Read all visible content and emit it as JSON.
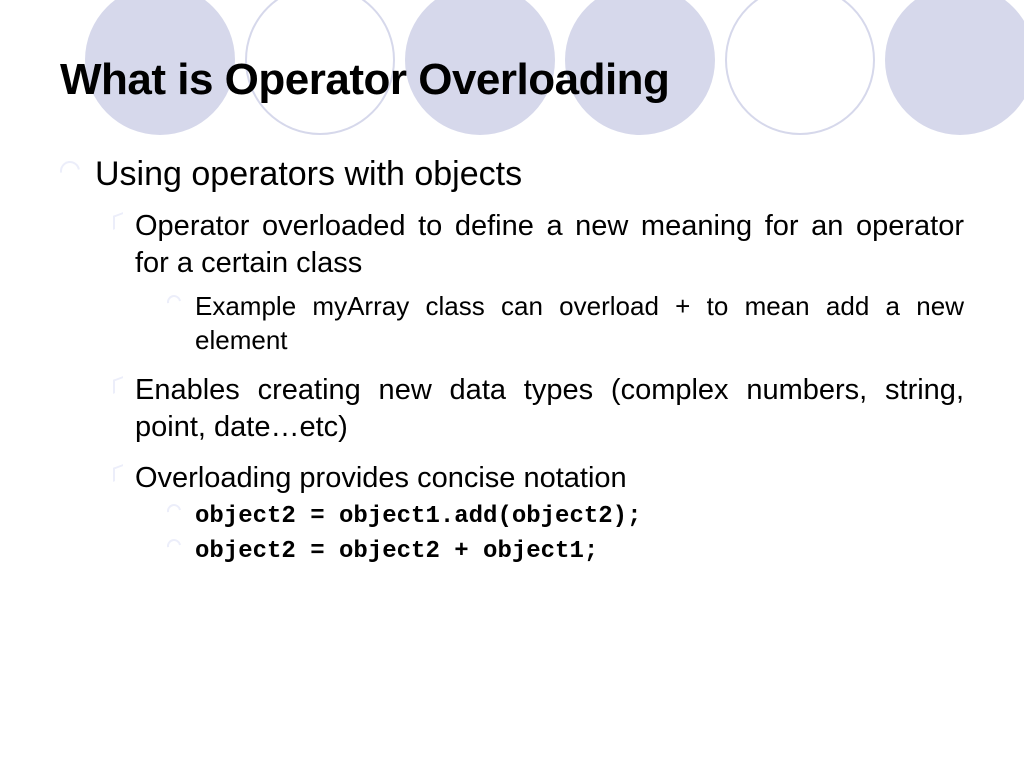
{
  "title": "What is Operator Overloading",
  "colors": {
    "circle_fill": "#d6d8eb",
    "bullet": "#eceefa"
  },
  "lvl1": {
    "text": "Using operators with objects"
  },
  "lvl2": {
    "a": "Operator overloaded to define a new meaning for an operator for a certain class",
    "b": "Enables creating new data types (complex numbers, string, point, date…etc)",
    "c": "Overloading provides concise notation"
  },
  "lvl3": {
    "example": "Example myArray class can overload + to mean add a new element",
    "code1": "object2 = object1.add(object2);",
    "code2": "object2 = object2 + object1;"
  }
}
